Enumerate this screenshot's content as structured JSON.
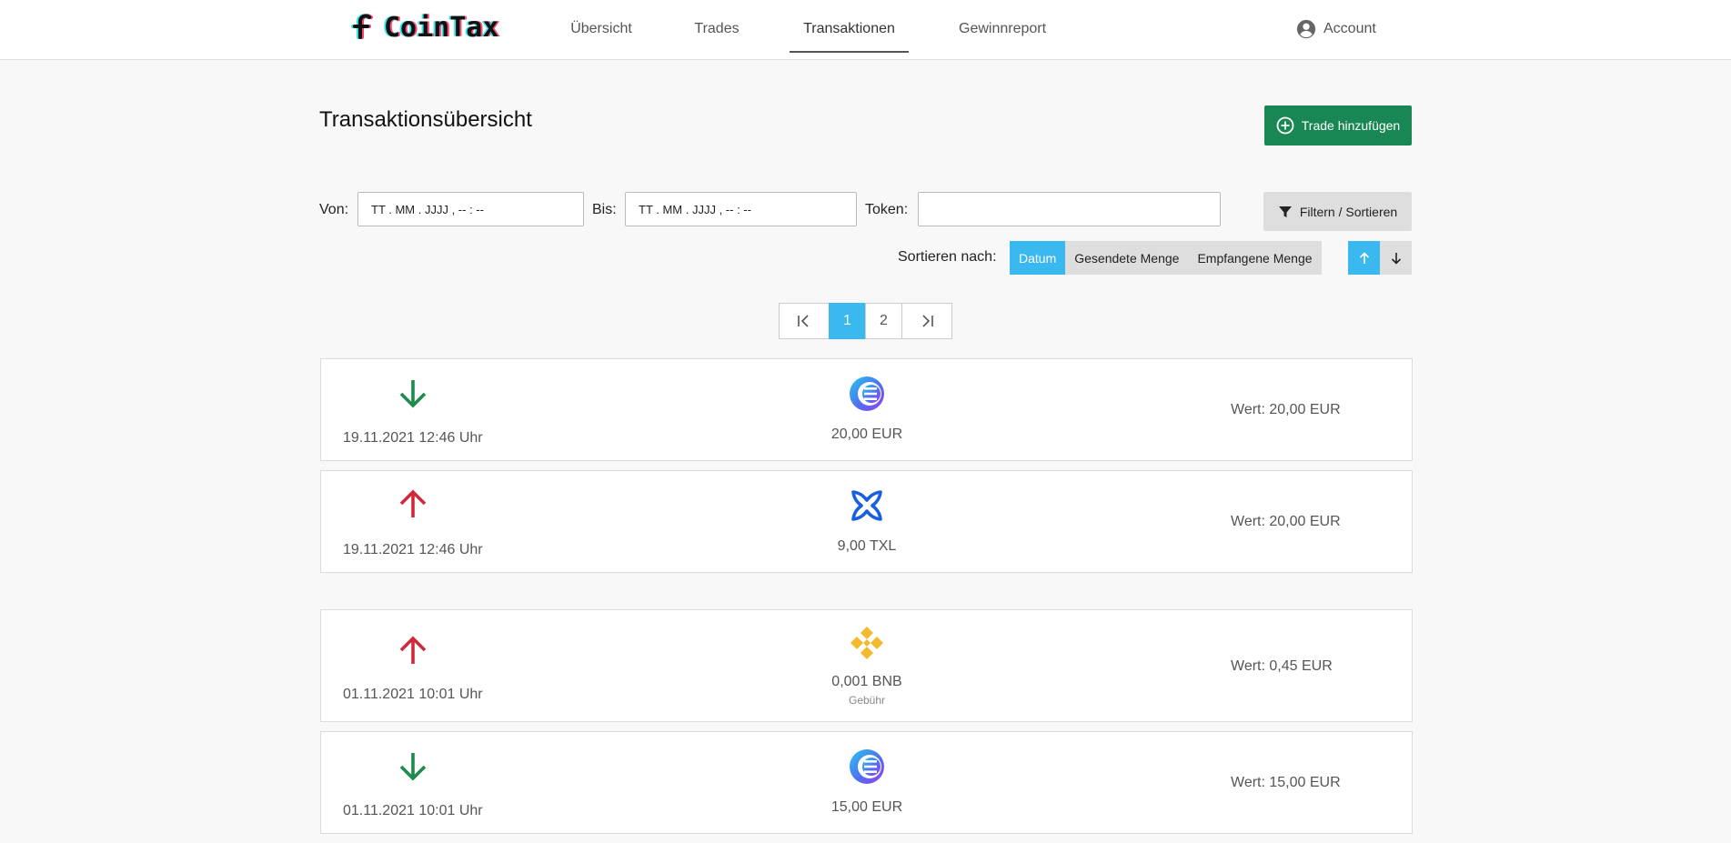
{
  "app": {
    "name": "CoinTax"
  },
  "nav": {
    "items": [
      {
        "label": "Übersicht",
        "active": false
      },
      {
        "label": "Trades",
        "active": false
      },
      {
        "label": "Transaktionen",
        "active": true
      },
      {
        "label": "Gewinnreport",
        "active": false
      }
    ],
    "account_label": "Account"
  },
  "page": {
    "title": "Transaktionsübersicht",
    "add_trade_label": "Trade hinzufügen"
  },
  "filters": {
    "from_label": "Von:",
    "from_placeholder": "TT . MM . JJJJ ,  -- : --",
    "to_label": "Bis:",
    "to_placeholder": "TT . MM . JJJJ ,  -- : --",
    "token_label": "Token:",
    "token_value": "",
    "filter_button_label": "Filtern / Sortieren"
  },
  "sort": {
    "label": "Sortieren nach:",
    "options": [
      {
        "label": "Datum",
        "active": true
      },
      {
        "label": "Gesendete Menge",
        "active": false
      },
      {
        "label": "Empfangene Menge",
        "active": false
      }
    ],
    "direction": "ascending"
  },
  "pagination": {
    "first_icon": "first-page-icon",
    "pages": [
      {
        "label": "1",
        "active": true
      },
      {
        "label": "2",
        "active": false
      }
    ],
    "last_icon": "last-page-icon"
  },
  "colors": {
    "accent_blue": "#3ab8f0",
    "success_green": "#198754",
    "incoming_arrow": "#1e8a4c",
    "outgoing_arrow": "#d0293a",
    "bnb_yellow": "#f3ba2f",
    "txl_blue": "#1a5fe0"
  },
  "transactions": [
    {
      "direction": "incoming",
      "direction_icon": "arrow-down-icon",
      "date": "19.11.2021 12:46 Uhr",
      "coin_icon": "euro-stablecoin-icon",
      "amount": "20,00 EUR",
      "note": "",
      "value": "Wert: 20,00 EUR"
    },
    {
      "direction": "outgoing",
      "direction_icon": "arrow-up-icon",
      "date": "19.11.2021 12:46 Uhr",
      "coin_icon": "txl-token-icon",
      "amount": "9,00 TXL",
      "note": "",
      "value": "Wert: 20,00 EUR"
    },
    {
      "direction": "outgoing",
      "direction_icon": "arrow-up-icon",
      "date": "01.11.2021 10:01 Uhr",
      "coin_icon": "bnb-icon",
      "amount": "0,001 BNB",
      "note": "Gebühr",
      "value": "Wert: 0,45 EUR"
    },
    {
      "direction": "incoming",
      "direction_icon": "arrow-down-icon",
      "date": "01.11.2021 10:01 Uhr",
      "coin_icon": "euro-stablecoin-icon",
      "amount": "15,00 EUR",
      "note": "",
      "value": "Wert: 15,00 EUR"
    }
  ]
}
